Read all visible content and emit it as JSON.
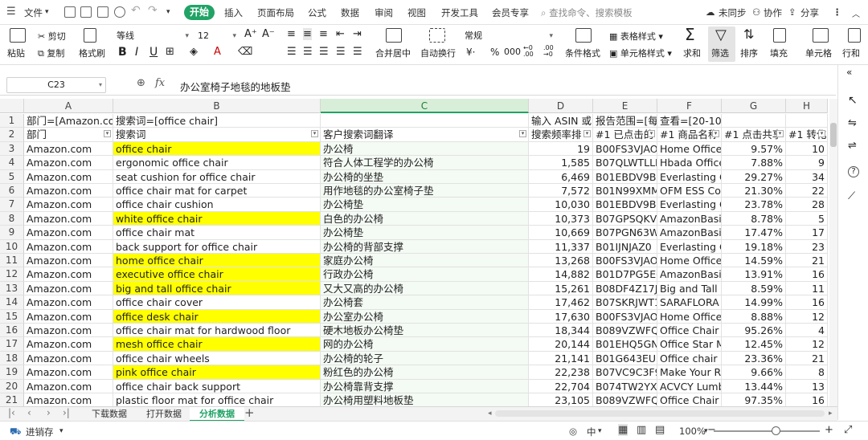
{
  "menubar": {
    "file": "文件",
    "start": "开始",
    "tabs": [
      "插入",
      "页面布局",
      "公式",
      "数据",
      "审阅",
      "视图",
      "开发工具",
      "会员专享"
    ],
    "search_placeholder": "查找命令、搜索模板",
    "unsynced": "未同步",
    "collab": "协作",
    "share": "分享"
  },
  "ribbon": {
    "paste": "粘贴",
    "cut": "剪切",
    "copy": "复制",
    "format_painter": "格式刷",
    "font_name": "等线",
    "font_size": "12",
    "merge": "合并居中",
    "wrap": "自动换行",
    "number_format": "常规",
    "cond_format": "条件格式",
    "table_style": "表格样式",
    "cell_style": "单元格样式",
    "sum": "求和",
    "filter": "筛选",
    "sort": "排序",
    "fill": "填充",
    "cell": "单元格",
    "rowcol": "行和"
  },
  "formula_bar": {
    "cell_ref": "C23",
    "fx": "fx",
    "content": "办公室椅子地毯的地板垫"
  },
  "columns": [
    "A",
    "B",
    "C",
    "D",
    "E",
    "F",
    "G",
    "H"
  ],
  "selected_column": "C",
  "rows": [
    {
      "n": "1",
      "A": "部门=[Amazon.com]",
      "B": "搜索词=[office chair]",
      "C": "",
      "D": "输入 ASIN 或",
      "E": "报告范围=[每",
      "F": "查看=[20-10-11 - 20-10-17]",
      "G": "",
      "H": ""
    },
    {
      "n": "2",
      "A": "部门",
      "B": "搜索词",
      "C": "客户搜索词翻译",
      "D": "搜索频率排",
      "E": "#1 已点击的",
      "F": "#1 商品名称",
      "G": "#1 点击共享",
      "H": "#1 转化"
    },
    {
      "n": "3",
      "A": "Amazon.com",
      "B": "office chair",
      "C": "办公椅",
      "D": "19",
      "E": "B00FS3VJAO",
      "F": "Home Office",
      "G": "9.57%",
      "H": "10",
      "hl": true
    },
    {
      "n": "4",
      "A": "Amazon.com",
      "B": "ergonomic office chair",
      "C": "符合人体工程学的办公椅",
      "D": "1,585",
      "E": "B07QLWTLLN",
      "F": "Hbada Office",
      "G": "7.88%",
      "H": "9"
    },
    {
      "n": "5",
      "A": "Amazon.com",
      "B": "seat cushion for office chair",
      "C": "办公椅的坐垫",
      "D": "6,469",
      "E": "B01EBDV9BU",
      "F": "Everlasting Co",
      "G": "29.27%",
      "H": "34"
    },
    {
      "n": "6",
      "A": "Amazon.com",
      "B": "office chair mat for carpet",
      "C": "用作地毯的办公室椅子垫",
      "D": "7,572",
      "E": "B01N99XMM",
      "F": "OFM ESS Coll",
      "G": "21.30%",
      "H": "22"
    },
    {
      "n": "7",
      "A": "Amazon.com",
      "B": "office chair cushion",
      "C": "办公椅垫",
      "D": "10,030",
      "E": "B01EBDV9BU",
      "F": "Everlasting Co",
      "G": "23.78%",
      "H": "28"
    },
    {
      "n": "8",
      "A": "Amazon.com",
      "B": "white office chair",
      "C": "白色的办公椅",
      "D": "10,373",
      "E": "B07GPSQKV9",
      "F": "AmazonBasics",
      "G": "8.78%",
      "H": "5",
      "hl": true
    },
    {
      "n": "9",
      "A": "Amazon.com",
      "B": "office chair mat",
      "C": "办公椅垫",
      "D": "10,669",
      "E": "B07PGN63W5",
      "F": "AmazonBasics",
      "G": "17.47%",
      "H": "17"
    },
    {
      "n": "10",
      "A": "Amazon.com",
      "B": "back support for office chair",
      "C": "办公椅的背部支撑",
      "D": "11,337",
      "E": "B01IJNJAZ0",
      "F": "Everlasting Co",
      "G": "19.18%",
      "H": "23"
    },
    {
      "n": "11",
      "A": "Amazon.com",
      "B": "home office chair",
      "C": "家庭办公椅",
      "D": "13,268",
      "E": "B00FS3VJAO",
      "F": "Home Office",
      "G": "14.59%",
      "H": "21",
      "hl": true
    },
    {
      "n": "12",
      "A": "Amazon.com",
      "B": "executive office chair",
      "C": "行政办公椅",
      "D": "14,882",
      "E": "B01D7PG5EC",
      "F": "AmazonBasics",
      "G": "13.91%",
      "H": "16",
      "hl": true
    },
    {
      "n": "13",
      "A": "Amazon.com",
      "B": "big and tall office chair",
      "C": "又大又高的办公椅",
      "D": "15,261",
      "E": "B08DF4Z17J",
      "F": "Big and Tall 5",
      "G": "8.59%",
      "H": "11",
      "hl": true
    },
    {
      "n": "14",
      "A": "Amazon.com",
      "B": "office chair cover",
      "C": "办公椅套",
      "D": "17,462",
      "E": "B07SKRJWT1",
      "F": "SARAFLORA C",
      "G": "14.99%",
      "H": "16"
    },
    {
      "n": "15",
      "A": "Amazon.com",
      "B": "office desk chair",
      "C": "办公室办公椅",
      "D": "17,630",
      "E": "B00FS3VJAO",
      "F": "Home Office",
      "G": "8.88%",
      "H": "12",
      "hl": true
    },
    {
      "n": "16",
      "A": "Amazon.com",
      "B": "office chair mat for hardwood floor",
      "C": "硬木地板办公椅垫",
      "D": "18,344",
      "E": "B089VZWFQI",
      "F": "Office Chair M",
      "G": "95.26%",
      "H": "4"
    },
    {
      "n": "17",
      "A": "Amazon.com",
      "B": "mesh office chair",
      "C": "网的办公椅",
      "D": "20,144",
      "E": "B01EHQ5GN5",
      "F": "Office Star M",
      "G": "12.45%",
      "H": "12",
      "hl": true
    },
    {
      "n": "18",
      "A": "Amazon.com",
      "B": "office chair wheels",
      "C": "办公椅的轮子",
      "D": "21,141",
      "E": "B01G643EU6",
      "F": "Office chair w",
      "G": "23.36%",
      "H": "21"
    },
    {
      "n": "19",
      "A": "Amazon.com",
      "B": "pink office chair",
      "C": "粉红色的办公椅",
      "D": "22,238",
      "E": "B07VC9C3F9",
      "F": "Make Your Ro",
      "G": "9.66%",
      "H": "8",
      "hl": true
    },
    {
      "n": "20",
      "A": "Amazon.com",
      "B": "office chair back support",
      "C": "办公椅靠背支撑",
      "D": "22,704",
      "E": "B074TW2YXF",
      "F": "ACVCY Lumb",
      "G": "13.44%",
      "H": "13"
    },
    {
      "n": "21",
      "A": "Amazon.com",
      "B": "plastic floor mat for office chair",
      "C": "办公椅用塑料地板垫",
      "D": "23,105",
      "E": "B089VZWFQI",
      "F": "Office Chair M",
      "G": "97.35%",
      "H": "16"
    }
  ],
  "sheets": [
    "下载数据",
    "打开数据",
    "分析数据"
  ],
  "active_sheet": "分析数据",
  "statusbar": {
    "inventory": "进销存",
    "input_mode": "中",
    "zoom": "100%"
  },
  "colors": {
    "accent": "#21a366",
    "highlight": "#ffff00"
  }
}
